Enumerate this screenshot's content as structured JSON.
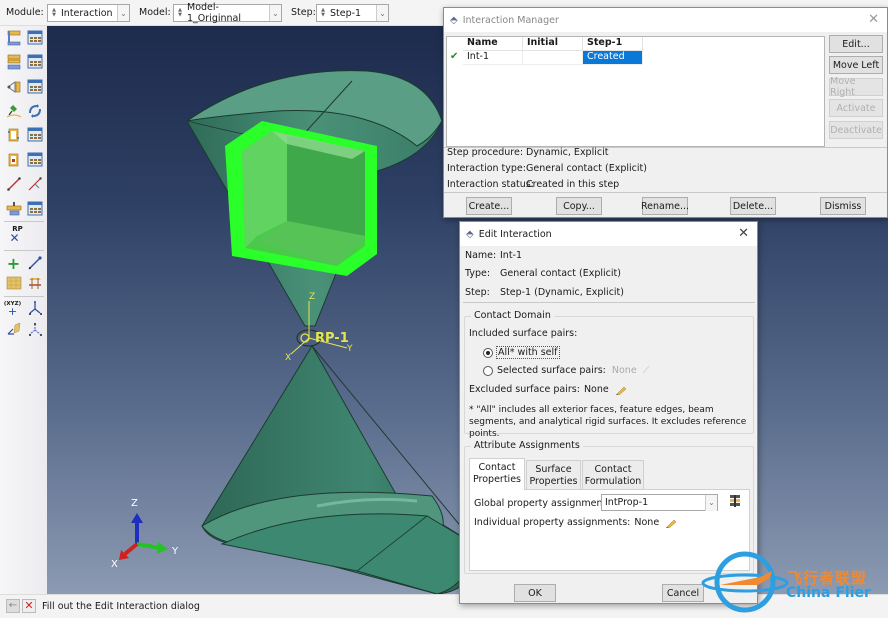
{
  "topbar": {
    "module_label": "Module:",
    "module_value": "Interaction",
    "model_label": "Model:",
    "model_value": "Model-1_Originnal",
    "step_label": "Step:",
    "step_value": "Step-1"
  },
  "toolbox": {
    "icons": [
      "interaction-create-icon",
      "interaction-manager-icon",
      "interaction-property-create-icon",
      "interaction-property-manager-icon",
      "contact-control-create-icon",
      "contact-control-manager-icon",
      "find-contact-pairs-icon",
      "contact-initialization-icon",
      "constraint-create-icon",
      "constraint-manager-icon",
      "connector-section-icon",
      "connector-section-manager-icon",
      "wire-create-icon",
      "wire-edit-icon",
      "special-create-icon",
      "special-manager-icon",
      "reference-point-icon",
      "datum-point-icon",
      "datum-axis-icon",
      "datum-plane-icon",
      "datum-csys-icon",
      "partition-icon",
      "datum-transform-icon",
      "query-icon"
    ],
    "rp_label": "RP"
  },
  "viewport": {
    "rp_label": "RP-1",
    "triad": {
      "x": "X",
      "y": "Y",
      "z": "Z"
    },
    "local_csys": {
      "x": "X",
      "y": "Y",
      "z": "Z"
    },
    "colors": {
      "part": "#3f8a70",
      "selection": "#2aff2a",
      "rp": "#e6e64a"
    }
  },
  "interaction_manager": {
    "title": "Interaction Manager",
    "columns": [
      "Name",
      "Initial",
      "Step-1"
    ],
    "rows": [
      {
        "active": true,
        "name": "Int-1",
        "initial": "",
        "step1": "Created"
      }
    ],
    "side_buttons": [
      {
        "label": "Edit...",
        "enabled": true
      },
      {
        "label": "Move Left",
        "enabled": true
      },
      {
        "label": "Move Right",
        "enabled": false
      },
      {
        "label": "Activate",
        "enabled": false
      },
      {
        "label": "Deactivate",
        "enabled": false
      }
    ],
    "info": {
      "step_procedure_label": "Step procedure:",
      "step_procedure": "Dynamic, Explicit",
      "interaction_type_label": "Interaction type:",
      "interaction_type": "General contact (Explicit)",
      "interaction_status_label": "Interaction status:",
      "interaction_status": "Created in this step"
    },
    "bottom_buttons": [
      "Create...",
      "Copy...",
      "Rename...",
      "Delete...",
      "Dismiss"
    ]
  },
  "edit_interaction": {
    "title": "Edit Interaction",
    "name_label": "Name:",
    "name": "Int-1",
    "type_label": "Type:",
    "type": "General contact (Explicit)",
    "step_label": "Step:",
    "step": "Step-1 (Dynamic, Explicit)",
    "contact_domain": {
      "title": "Contact Domain",
      "included_label": "Included surface pairs:",
      "option_all": "All* with self",
      "option_selected": "Selected surface pairs:",
      "selected_value": "None",
      "selected_option": "all",
      "excluded_label": "Excluded surface pairs:",
      "excluded_value": "None",
      "note": "* \"All\" includes all exterior faces, feature edges, beam segments, and analytical rigid surfaces. It excludes reference points."
    },
    "attribute_assignments": {
      "title": "Attribute Assignments",
      "tabs": [
        {
          "line1": "Contact",
          "line2": "Properties",
          "active": true
        },
        {
          "line1": "Surface",
          "line2": "Properties",
          "active": false
        },
        {
          "line1": "Contact",
          "line2": "Formulation",
          "active": false
        }
      ],
      "global_label": "Global property assignment:",
      "global_value": "IntProp-1",
      "individual_label": "Individual property assignments:",
      "individual_value": "None"
    },
    "ok_label": "OK",
    "cancel_label": "Cancel"
  },
  "statusbar": {
    "message": "Fill out the Edit Interaction dialog"
  },
  "watermark": {
    "cn": "飞行者联盟",
    "en": "China Flier"
  }
}
